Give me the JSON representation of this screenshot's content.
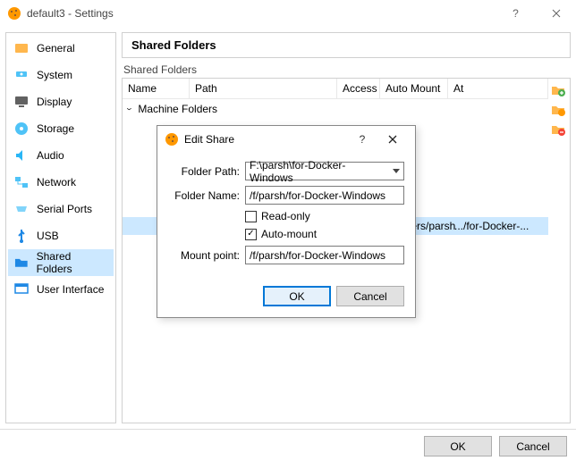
{
  "window": {
    "title": "default3 - Settings"
  },
  "sidebar": {
    "items": [
      {
        "label": "General"
      },
      {
        "label": "System"
      },
      {
        "label": "Display"
      },
      {
        "label": "Storage"
      },
      {
        "label": "Audio"
      },
      {
        "label": "Network"
      },
      {
        "label": "Serial Ports"
      },
      {
        "label": "USB"
      },
      {
        "label": "Shared Folders"
      },
      {
        "label": "User Interface"
      }
    ]
  },
  "main": {
    "header": "Shared Folders",
    "group_label": "Shared Folders",
    "columns": {
      "name": "Name",
      "path": "Path",
      "access": "Access",
      "auto_mount": "Auto Mount",
      "at": "At"
    },
    "machine_folders_label": "Machine Folders",
    "shared_entry": {
      "path_short": "/c/Users/parsh",
      "at_short": ".../for-Docker-..."
    }
  },
  "dialog": {
    "title": "Edit Share",
    "folder_path_label": "Folder Path:",
    "folder_path_value": "F:\\parsh\\for-Docker-Windows",
    "folder_name_label": "Folder Name:",
    "folder_name_value": "/f/parsh/for-Docker-Windows",
    "read_only_label": "Read-only",
    "read_only_checked": false,
    "auto_mount_label": "Auto-mount",
    "auto_mount_checked": true,
    "mount_point_label": "Mount point:",
    "mount_point_value": "/f/parsh/for-Docker-Windows",
    "ok": "OK",
    "cancel": "Cancel"
  },
  "footer": {
    "ok": "OK",
    "cancel": "Cancel"
  }
}
